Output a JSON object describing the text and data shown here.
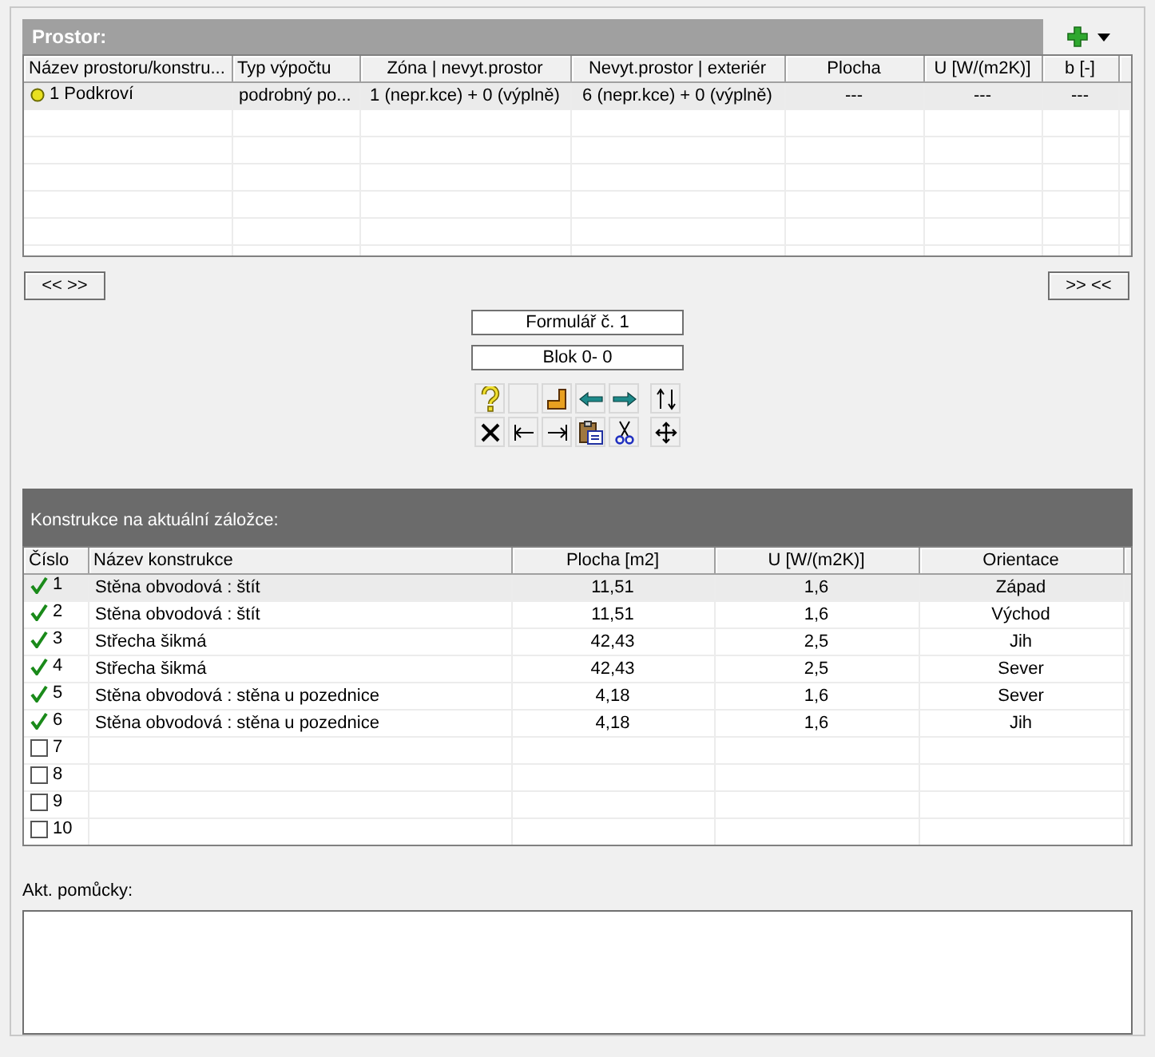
{
  "space_panel": {
    "title": "Prostor:",
    "columns": [
      "Název prostoru/konstru...",
      "Typ výpočtu",
      "Zóna | nevyt.prostor",
      "Nevyt.prostor | exteriér",
      "Plocha",
      "U [W/(m2K)]",
      "b [-]"
    ],
    "rows": [
      {
        "selected": true,
        "cells": [
          "1  Podkroví",
          "podrobný po...",
          "1 (nepr.kce) + 0 (výplně)",
          "6 (nepr.kce) + 0 (výplně)",
          "---",
          "---",
          "---"
        ]
      }
    ]
  },
  "nav_buttons": [
    "<< >>",
    ">> <<"
  ],
  "form_label": "Formulář č.  1",
  "block_label": "Blok  0-  0",
  "constructions_panel": {
    "title": "Konstrukce na aktuální záložce:",
    "columns": [
      "Číslo",
      "Název konstrukce",
      "Plocha [m2]",
      "U [W/(m2K)]",
      "Orientace"
    ],
    "rows": [
      {
        "checked": true,
        "selected": true,
        "cells": [
          "1",
          "Stěna obvodová : štít",
          "11,51",
          "1,6",
          "Západ"
        ]
      },
      {
        "checked": true,
        "selected": false,
        "cells": [
          "2",
          "Stěna obvodová : štít",
          "11,51",
          "1,6",
          "Východ"
        ]
      },
      {
        "checked": true,
        "selected": false,
        "cells": [
          "3",
          "Střecha šikmá",
          "42,43",
          "2,5",
          "Jih"
        ]
      },
      {
        "checked": true,
        "selected": false,
        "cells": [
          "4",
          "Střecha šikmá",
          "42,43",
          "2,5",
          "Sever"
        ]
      },
      {
        "checked": true,
        "selected": false,
        "cells": [
          "5",
          "Stěna obvodová : stěna u pozednice",
          "4,18",
          "1,6",
          "Sever"
        ]
      },
      {
        "checked": true,
        "selected": false,
        "cells": [
          "6",
          "Stěna obvodová : stěna u pozednice",
          "4,18",
          "1,6",
          "Jih"
        ]
      },
      {
        "checked": false,
        "selected": false,
        "cells": [
          "7"
        ]
      },
      {
        "checked": false,
        "selected": false,
        "cells": [
          "8"
        ]
      },
      {
        "checked": false,
        "selected": false,
        "cells": [
          "9"
        ]
      },
      {
        "checked": false,
        "selected": false,
        "cells": [
          "10"
        ]
      }
    ]
  },
  "aids": {
    "label": "Akt. pomůcky:"
  }
}
